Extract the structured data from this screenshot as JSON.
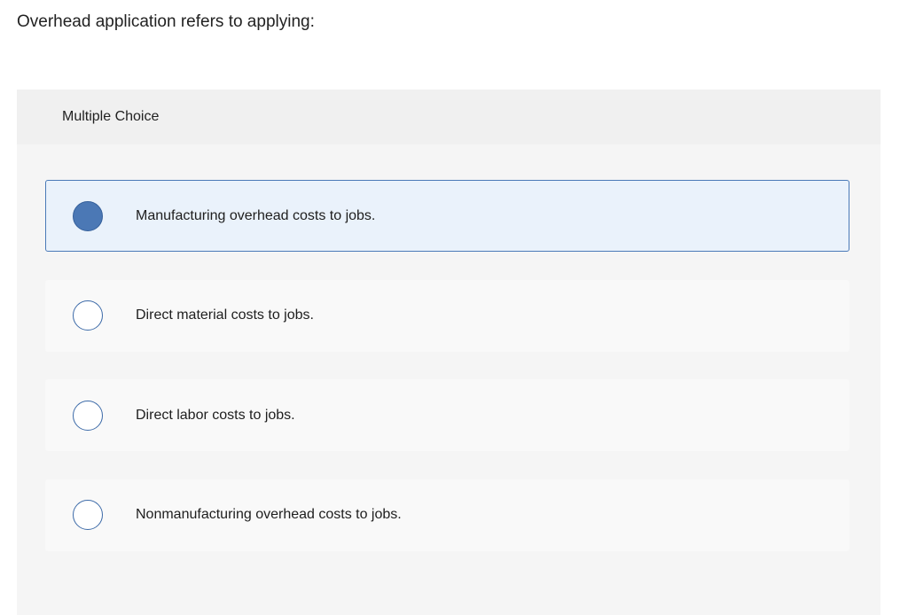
{
  "question": {
    "text": "Overhead application refers to applying:"
  },
  "panel": {
    "header": "Multiple Choice"
  },
  "choices": [
    {
      "label": "Manufacturing overhead costs to jobs.",
      "selected": true
    },
    {
      "label": "Direct material costs to jobs.",
      "selected": false
    },
    {
      "label": "Direct labor costs to jobs.",
      "selected": false
    },
    {
      "label": "Nonmanufacturing overhead costs to jobs.",
      "selected": false
    }
  ],
  "colors": {
    "selected_fill": "#4b78b5",
    "selected_border": "#4a7ab8",
    "selected_background": "#eaf2fb"
  }
}
